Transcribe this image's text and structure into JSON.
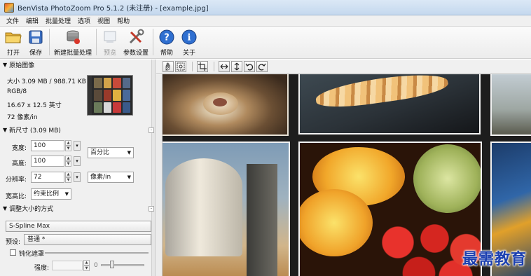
{
  "window": {
    "title": "BenVista PhotoZoom Pro 5.1.2 (未注册) - [example.jpg]"
  },
  "menu": [
    "文件",
    "编辑",
    "批量处理",
    "选项",
    "视图",
    "帮助"
  ],
  "toolbar": {
    "open": "打开",
    "save": "保存",
    "new_batch": "新建批量处理",
    "preview": "预览",
    "params": "参数设置",
    "help": "帮助",
    "about": "关于"
  },
  "original": {
    "header": "原始图像",
    "size": "大小 3.09 MB / 988.71 KB",
    "mode": "RGB/8",
    "dimensions": "16.67 x 12.5 英寸",
    "resolution": "72 像素/in"
  },
  "new_size": {
    "header": "新尺寸 (3.09 MB)",
    "width_label": "宽度:",
    "width_value": "100",
    "height_label": "高度:",
    "height_value": "100",
    "resolution_label": "分辨率:",
    "resolution_value": "72",
    "unit_percent": "百分比",
    "unit_resolution": "像素/in",
    "ratio_label": "宽高比:",
    "ratio_value": "约束比例"
  },
  "resize_method": {
    "header": "调整大小的方式",
    "method": "S-Spline Max",
    "preset_label": "预设:",
    "preset_value": "普通 *",
    "unsharp_label": "钝化遮罩",
    "strength_label": "强度:",
    "strength_value": "0"
  },
  "watermark": "最需教育",
  "colors": {
    "accent": "#1b3fb0",
    "titlebar": "#c4d8ee"
  }
}
